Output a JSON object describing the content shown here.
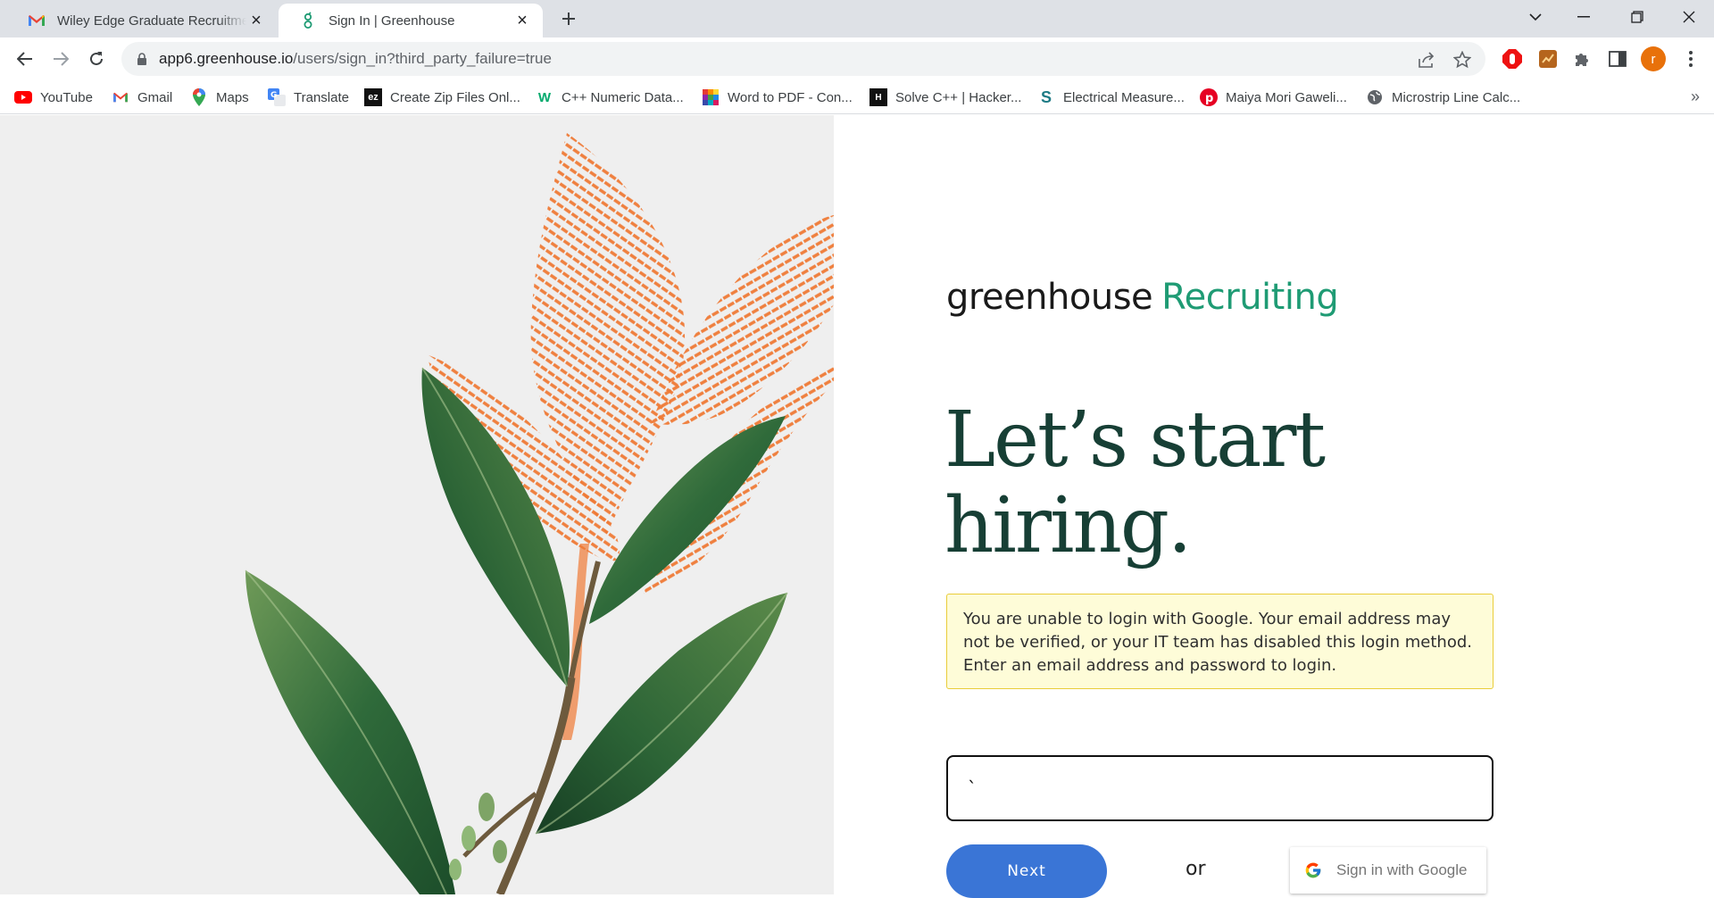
{
  "browser": {
    "tabs": [
      {
        "title": "Wiley Edge Graduate Recruitment",
        "favicon": "gmail-icon",
        "active": false
      },
      {
        "title": "Sign In | Greenhouse",
        "favicon": "greenhouse-icon",
        "active": true
      }
    ],
    "url_host": "app6.greenhouse.io",
    "url_path": "/users/sign_in?third_party_failure=true",
    "profile_initial": "r",
    "bookmarks": [
      {
        "label": "YouTube",
        "icon": "youtube-icon"
      },
      {
        "label": "Gmail",
        "icon": "gmail-icon"
      },
      {
        "label": "Maps",
        "icon": "maps-icon"
      },
      {
        "label": "Translate",
        "icon": "translate-icon"
      },
      {
        "label": "Create Zip Files Onl...",
        "icon": "ezyzip-icon"
      },
      {
        "label": "C++ Numeric Data...",
        "icon": "w3schools-icon"
      },
      {
        "label": "Word to PDF - Con...",
        "icon": "wordtopdf-icon"
      },
      {
        "label": "Solve C++ | Hacker...",
        "icon": "hackerrank-icon"
      },
      {
        "label": "Electrical Measure...",
        "icon": "scribd-icon"
      },
      {
        "label": "Maiya Mori Gaweli...",
        "icon": "pinterest-icon"
      },
      {
        "label": "Microstrip Line Calc...",
        "icon": "globe-icon"
      }
    ],
    "more_bookmarks": "»"
  },
  "page": {
    "logo_word": "greenhouse",
    "logo_product": "Recruiting",
    "headline_line1": "Let’s start",
    "headline_line2": "hiring.",
    "alert_text": "You are unable to login with Google. Your email address may not be verified, or your IT team has disabled this login method. Enter an email address and password to login.",
    "email_value": "`",
    "next_label": "Next",
    "or_label": "or",
    "google_label": "Sign in with Google"
  },
  "colors": {
    "brand_green": "#1f9b74",
    "headline": "#173f35",
    "primary_button": "#3a75d6",
    "alert_bg": "#fefcd8",
    "alert_border": "#e9cd3a",
    "fingerprint": "#ef7a36"
  }
}
